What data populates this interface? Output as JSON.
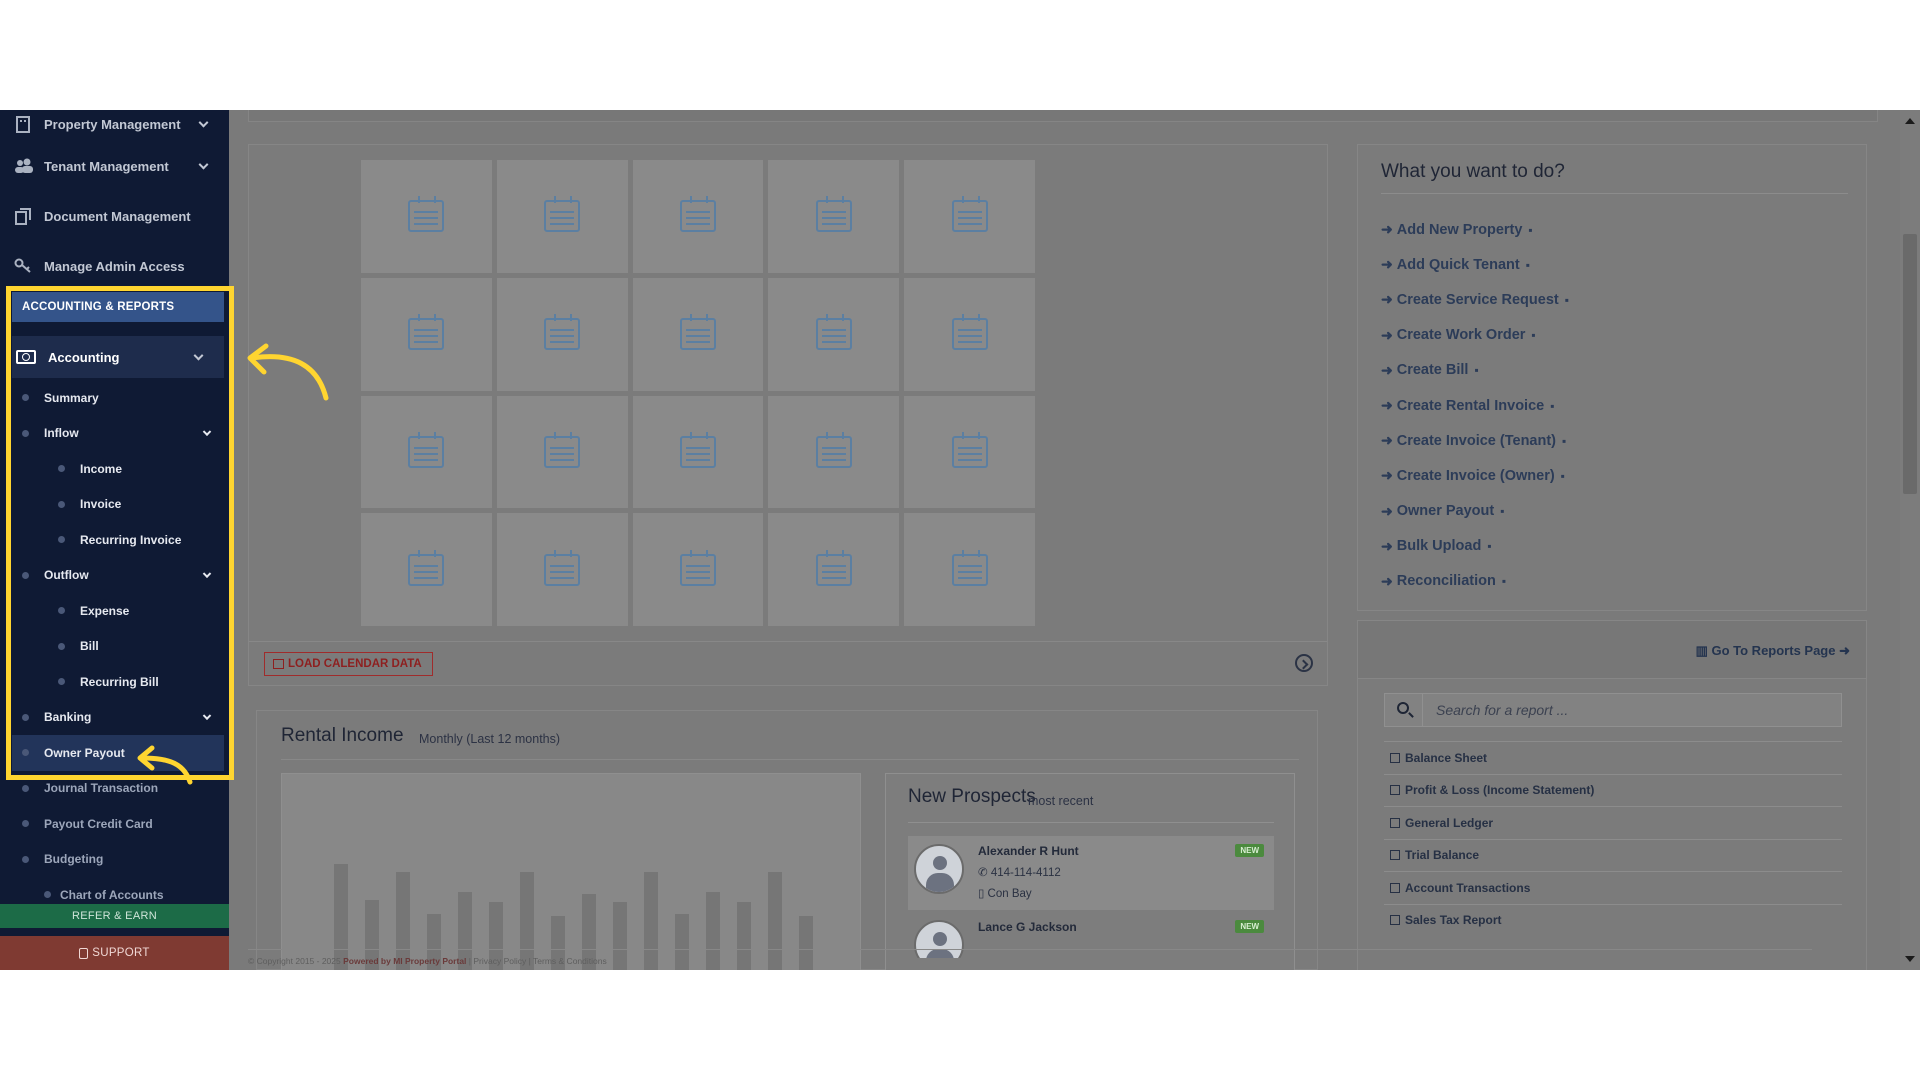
{
  "sidebar": {
    "top_items": [
      {
        "label": "Property Management",
        "icon": "building-icon"
      },
      {
        "label": "Tenant Management",
        "icon": "users-icon"
      },
      {
        "label": "Document Management",
        "icon": "documents-icon"
      },
      {
        "label": "Manage Admin Access",
        "icon": "key-icon"
      }
    ],
    "section_header": "ACCOUNTING & REPORTS",
    "accounting_label": "Accounting",
    "sub_items": [
      {
        "label": "Summary"
      },
      {
        "label": "Inflow"
      },
      {
        "label": "Income"
      },
      {
        "label": "Invoice"
      },
      {
        "label": "Recurring Invoice"
      },
      {
        "label": "Outflow"
      },
      {
        "label": "Expense"
      },
      {
        "label": "Bill"
      },
      {
        "label": "Recurring Bill"
      },
      {
        "label": "Banking"
      },
      {
        "label": "Owner Payout"
      },
      {
        "label": "Journal Transaction"
      },
      {
        "label": "Payout Credit Card"
      },
      {
        "label": "Budgeting"
      },
      {
        "label": "Chart of Accounts"
      }
    ],
    "refer_label": "REFER & EARN",
    "support_label": "SUPPORT"
  },
  "calendar": {
    "load_button": "LOAD CALENDAR DATA",
    "placeholder_icon": "calendar-icon",
    "cell_count": 20
  },
  "rental_income": {
    "title": "Rental Income",
    "subtitle": "Monthly (Last 12 months)"
  },
  "prospects": {
    "title": "New Prospects",
    "subtitle": "most recent",
    "items": [
      {
        "name": "Alexander R Hunt",
        "phone": "414-114-4112",
        "address": "Con Bay",
        "badge": "NEW"
      },
      {
        "name": "Lance G Jackson",
        "phone": "",
        "address": "",
        "badge": "NEW"
      }
    ]
  },
  "todo": {
    "title": "What you want to do?",
    "actions": [
      {
        "label": "Add New Property",
        "icon": "building-icon"
      },
      {
        "label": "Add Quick Tenant",
        "icon": "user-icon"
      },
      {
        "label": "Create Service Request",
        "icon": "wrench-icon"
      },
      {
        "label": "Create Work Order",
        "icon": "wrench-icon"
      },
      {
        "label": "Create Bill",
        "icon": "copy-icon"
      },
      {
        "label": "Create Rental Invoice",
        "icon": "copy-icon"
      },
      {
        "label": "Create Invoice (Tenant)",
        "icon": "copy-icon"
      },
      {
        "label": "Create Invoice (Owner)",
        "icon": "copy-icon"
      },
      {
        "label": "Owner Payout",
        "icon": "copy-outline-icon"
      },
      {
        "label": "Bulk Upload",
        "icon": "database-icon"
      },
      {
        "label": "Reconciliation",
        "icon": "calculator-icon"
      }
    ]
  },
  "reports": {
    "goto_label": "Go To Reports Page",
    "search_placeholder": "Search for a report ...",
    "items": [
      {
        "label": "Balance Sheet"
      },
      {
        "label": "Profit & Loss (Income Statement)"
      },
      {
        "label": "General Ledger"
      },
      {
        "label": "Trial Balance"
      },
      {
        "label": "Account Transactions"
      },
      {
        "label": "Sales Tax Report"
      }
    ]
  },
  "footer": {
    "copyright": "© Copyright 2015 - 2025",
    "powered": "Powered by MI Property Portal",
    "privacy": "Privacy Policy",
    "terms": "Terms & Conditions"
  },
  "colors": {
    "sidebar_bg": "#0f1a34",
    "highlight": "#ffd530",
    "overlay_gray": "#7a7a7a",
    "refer_green": "#1c6b47",
    "support_red": "#7f3a32"
  }
}
